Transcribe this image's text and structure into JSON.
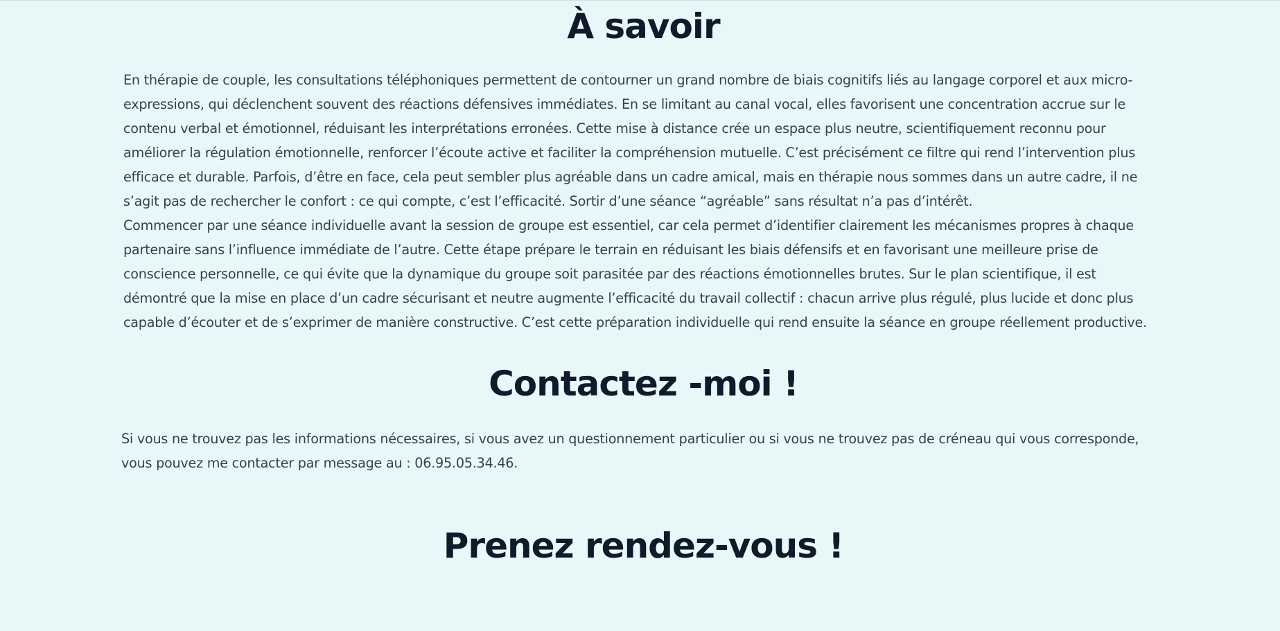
{
  "sections": {
    "savoir": {
      "title": "À savoir",
      "paragraphs": [
        "En thérapie de couple, les consultations téléphoniques permettent de contourner un grand nombre de biais cognitifs liés au langage corporel et aux micro-expressions, qui déclenchent souvent des réactions défensives immédiates. En se limitant au canal vocal, elles favorisent une concentration accrue sur le contenu verbal et émotionnel, réduisant les interprétations erronées. Cette mise à distance crée un espace plus neutre, scientifiquement reconnu pour améliorer la régulation émotionnelle, renforcer l’écoute active et faciliter la compréhension mutuelle. C’est précisément ce filtre qui rend l’intervention plus efficace et durable. Parfois, d’être en face, cela peut sembler plus agréable dans un cadre amical, mais en thérapie nous sommes dans un autre cadre, il ne s’agit pas de rechercher le confort : ce qui compte, c’est l’efficacité. Sortir d’une séance “agréable” sans résultat n’a pas d’intérêt.",
        "Commencer par une séance individuelle avant la session de groupe est essentiel, car cela permet d’identifier clairement les mécanismes propres à chaque partenaire sans l’influence immédiate de l’autre. Cette étape prépare le terrain en réduisant les biais défensifs et en favorisant une meilleure prise de conscience personnelle, ce qui évite que la dynamique du groupe soit parasitée par des réactions émotionnelles brutes. Sur le plan scientifique, il est démontré que la mise en place d’un cadre sécurisant et neutre augmente l’efficacité du travail collectif : chacun arrive plus régulé, plus lucide et donc plus capable d’écouter et de s’exprimer de manière constructive. C’est cette préparation individuelle qui rend ensuite la séance en groupe réellement productive."
      ]
    },
    "contact": {
      "title": "Contactez -moi !",
      "text": "Si vous ne trouvez pas les informations nécessaires, si vous avez un questionnement particulier ou si vous ne trouvez pas de créneau qui vous corresponde, vous pouvez me contacter par message au : 06.95.05.34.46."
    },
    "appointment": {
      "title": "Prenez rendez-vous !"
    }
  },
  "colors": {
    "background": "#e8f8f8",
    "heading": "#0f1a2b",
    "body_text": "#34414f"
  }
}
